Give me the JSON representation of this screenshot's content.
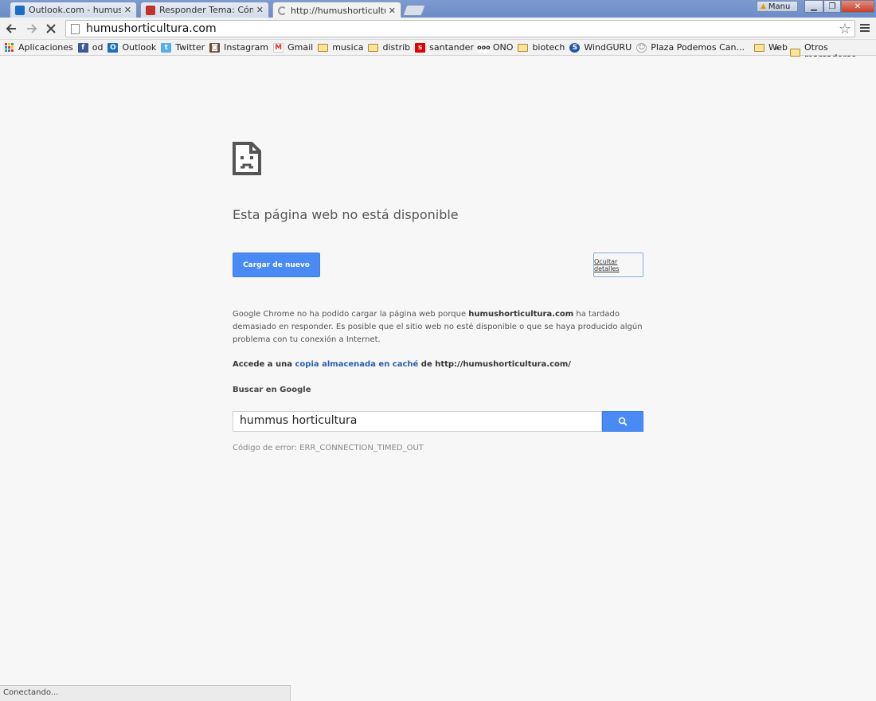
{
  "tabs": [
    {
      "title": "Outlook.com - humushort",
      "favicon_color": "#1d6ec2",
      "favicon_text": "O"
    },
    {
      "title": "Responder Tema: Cómo a",
      "favicon_color": "#c2322a",
      "favicon_text": "w"
    },
    {
      "title": "http://humushorticultura.c",
      "favicon_color": "#ffffff",
      "favicon_text": ""
    }
  ],
  "window": {
    "profile_label": "Manu"
  },
  "toolbar": {
    "url": "humushorticultura.com"
  },
  "bookmarks": [
    {
      "label": "Aplicaciones",
      "icon": "apps-grid-icon"
    },
    {
      "label": "od",
      "icon": "facebook-icon",
      "color": "#3b5998",
      "glyph": "f"
    },
    {
      "label": "Outlook",
      "icon": "outlook-icon",
      "color": "#1d6ec2",
      "glyph": "O"
    },
    {
      "label": "Twitter",
      "icon": "twitter-icon",
      "color": "#55acee",
      "glyph": "t"
    },
    {
      "label": "Instagram",
      "icon": "instagram-icon",
      "color": "#6b4b3a",
      "glyph": "◙"
    },
    {
      "label": "Gmail",
      "icon": "gmail-icon",
      "color": "#d93025",
      "glyph": "M"
    },
    {
      "label": "musica",
      "icon": "folder-icon"
    },
    {
      "label": "distrib",
      "icon": "folder-icon"
    },
    {
      "label": "santander",
      "icon": "santander-icon",
      "color": "#e30000",
      "glyph": "s"
    },
    {
      "label": "ONO",
      "icon": "ono-icon",
      "color": "#222222",
      "glyph": "•"
    },
    {
      "label": "biotech",
      "icon": "folder-icon"
    },
    {
      "label": "WindGURU",
      "icon": "windguru-icon",
      "color": "#2255aa",
      "glyph": "S"
    },
    {
      "label": "Plaza Podemos Can...",
      "icon": "reddit-icon",
      "color": "#888888",
      "glyph": "☺"
    },
    {
      "label": "Web",
      "icon": "folder-icon"
    }
  ],
  "bookmarks_more": "»",
  "bookmarks_other": "Otros marcadores",
  "page": {
    "title": "Esta página web no está disponible",
    "reload_label": "Cargar de nuevo",
    "details_label": "Ocultar detalles",
    "desc_part1": "Google Chrome no ha podido cargar la página web porque ",
    "desc_domain": "humushorticultura.com",
    "desc_part2": " ha tardado demasiado en responder. Es posible que el sitio web no esté disponible o que se haya producido algún problema con tu conexión a Internet.",
    "cache_prefix": "Accede a una ",
    "cache_link": "copia almacenada en caché",
    "cache_suffix": " de http://humushorticultura.com/",
    "search_label": "Buscar en Google",
    "search_value": "hummus horticultura",
    "error_code": "Código de error: ERR_CONNECTION_TIMED_OUT"
  },
  "status": "Conectando..."
}
